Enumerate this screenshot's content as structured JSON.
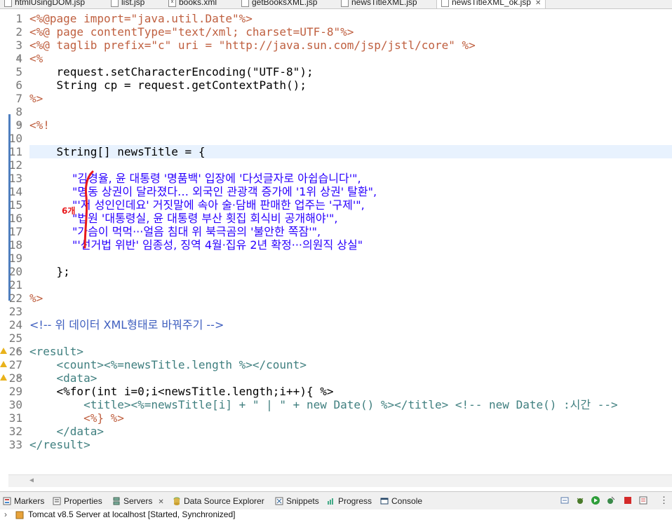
{
  "tabs": [
    {
      "label": "htmlUsingDOM.jsp",
      "icon": "jsp-file-icon",
      "active": false
    },
    {
      "label": "list.jsp",
      "icon": "jsp-file-icon",
      "active": false
    },
    {
      "label": "books.xml",
      "icon": "xml-file-icon",
      "active": false
    },
    {
      "label": "getBooksXML.jsp",
      "icon": "jsp-file-icon",
      "active": false
    },
    {
      "label": "newsTitleXML.jsp",
      "icon": "jsp-file-icon",
      "active": false
    },
    {
      "label": "newsTitleXML_ok.jsp",
      "icon": "jsp-file-icon",
      "active": true
    }
  ],
  "tab_close": "✕",
  "line_numbers": [
    "1",
    "2",
    "3",
    "4",
    "5",
    "6",
    "7",
    "8",
    "9",
    "10",
    "11",
    "12",
    "13",
    "14",
    "15",
    "16",
    "17",
    "18",
    "19",
    "20",
    "21",
    "22",
    "23",
    "24",
    "25",
    "26",
    "27",
    "28",
    "29",
    "30",
    "31",
    "32",
    "33"
  ],
  "code": {
    "l1": "<%@page import=\"java.util.Date\"%>",
    "l2": "<%@ page contentType=\"text/xml; charset=UTF-8\"%>",
    "l3": "<%@ taglib prefix=\"c\" uri = \"http://java.sun.com/jsp/jstl/core\" %>",
    "l4": "<%",
    "l5": "    request.setCharacterEncoding(\"UTF-8\");",
    "l6": "    String cp = request.getContextPath();",
    "l7": "%>",
    "l9": "<%!",
    "l11": "    String[] newsTitle = {",
    "l13": "            \"김경율, 윤 대통령 '명품백' 입장에 '다섯글자로 아쉽습니다'\",",
    "l14": "            \"명동 상권이 달라졌다… 외국인 관광객 증가에 '1위 상권' 탈환\",",
    "l15": "            \"'저 성인인데요' 거짓말에 속아 술·담배 판매한 업주는 '구제'\",",
    "l16": "            \"법원 '대통령실, 윤 대통령 부산 횟집 회식비 공개해야'\",",
    "l17": "            \"가슴이 먹먹···얼음 침대 위 북극곰의 '불안한 쪽잠'\",",
    "l18": "            \"'선거법 위반' 임종성, 징역 4월·집유 2년 확정···의원직 상실\"",
    "l20": "    };",
    "l22": "%>",
    "l24": "<!-- 위 데이터 XML형태로 바꿔주기 -->",
    "l26": "<result>",
    "l27": "    <count><%=newsTitle.length %></count>",
    "l28": "    <data>",
    "l29": "    <%for(int i=0;i<newsTitle.length;i++){ %>",
    "l30": "        <title><%=newsTitle[i] + \" | \" + new Date() %></title> <!-- new Date() :시간 -->",
    "l31": "        <%} %>",
    "l32": "    </data>",
    "l33": "</result>"
  },
  "annotation": {
    "label": "6개",
    "color": "#e8191c"
  },
  "bottom_panel": {
    "tabs": [
      {
        "label": "Markers",
        "icon": "markers-icon"
      },
      {
        "label": "Properties",
        "icon": "properties-icon"
      },
      {
        "label": "Servers",
        "icon": "servers-icon",
        "close": "✕"
      },
      {
        "label": "Data Source Explorer",
        "icon": "data-source-icon"
      },
      {
        "label": "Snippets",
        "icon": "snippets-icon"
      },
      {
        "label": "Progress",
        "icon": "progress-icon"
      },
      {
        "label": "Console",
        "icon": "console-icon"
      }
    ],
    "server_row": "Tomcat v8.5 Server at localhost  [Started, Synchronized]"
  },
  "colors": {
    "keyword": "#7f0055",
    "directive": "#bf5f3f",
    "tag": "#3f7f7f",
    "attribute": "#7f007f",
    "string": "#2a00ff",
    "comment": "#3f5fbf",
    "current_line": "#e8f2fe",
    "annotation": "#e8191c"
  }
}
